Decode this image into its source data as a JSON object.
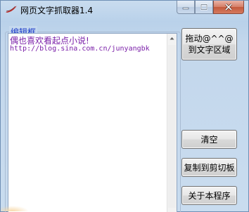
{
  "window": {
    "title": "网页文字抓取器1.4"
  },
  "caption_buttons": {
    "minimize_icon": "minimize-icon",
    "maximize_icon": "maximize-icon",
    "close_icon": "close-icon"
  },
  "editor": {
    "group_label": "编辑框",
    "lines": [
      "偶也喜欢看起点小说!",
      "http://blog.sina.com.cn/junyangbk"
    ]
  },
  "buttons": {
    "drag_target": "拖动@^^@到文字区域",
    "clear": "清空",
    "copy": "复制到剪切板",
    "about": "关于本程序"
  },
  "colors": {
    "text_accent": "#7a1fa8",
    "group_label": "#1a39c8",
    "window_bg": "#c9dcef"
  }
}
